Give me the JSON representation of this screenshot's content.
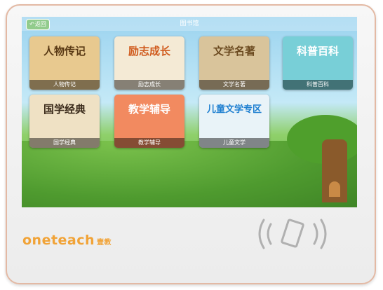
{
  "header": {
    "title": "图书馆",
    "back_label": "返回"
  },
  "cards": [
    {
      "title": "人物传记",
      "caption": "人物传记",
      "bg": "#e8c98f",
      "color": "#5a3a15"
    },
    {
      "title": "励志成长",
      "caption": "励志成长",
      "bg": "#f4ead5",
      "color": "#d05b1e"
    },
    {
      "title": "文学名著",
      "caption": "文学名著",
      "bg": "#d9c49b",
      "color": "#6b4a20"
    },
    {
      "title": "科普百科",
      "caption": "科普百科",
      "bg": "#78cfd7",
      "color": "#ffffff"
    },
    {
      "title": "国学经典",
      "caption": "国学经典",
      "bg": "#efe1c4",
      "color": "#3a2a1a"
    },
    {
      "title": "教学辅导",
      "caption": "教学辅导",
      "bg": "#f28a60",
      "color": "#ffffff"
    },
    {
      "title": "儿童文学专区",
      "caption": "儿童文学",
      "bg": "#e9f3f8",
      "color": "#1e7fd0"
    }
  ],
  "brand": {
    "name": "oneteach",
    "name_cn": "壹教",
    "color": "#f1a337"
  }
}
